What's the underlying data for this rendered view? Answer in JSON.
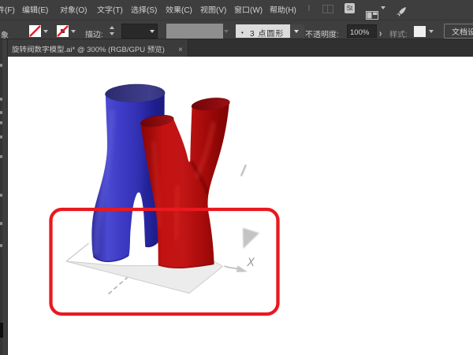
{
  "menu": {
    "items": [
      "文件(F)",
      "编辑(E)",
      "对象(O)",
      "文字(T)",
      "选择(S)",
      "效果(C)",
      "视图(V)",
      "窗口(W)",
      "帮助(H)"
    ],
    "stock_badge": "St"
  },
  "control_bar": {
    "selection_label_fragment": "象",
    "stroke_label": "描边:",
    "brush_bullet": "•",
    "brush_value": "3 点圆形",
    "opacity_label": "不透明度:",
    "opacity_value": "100%",
    "opacity_more": "›",
    "style_label": "样式:",
    "document_setup_label": "文档设置"
  },
  "document_tab": {
    "title": "旋转阀数字模型.ai* @ 300% (RGB/GPU 预览)",
    "close": "×"
  },
  "artwork": {
    "axis_label": "X",
    "colors": {
      "tube_blue": "#3e3cc6",
      "tube_blue_dark": "#1b1a7e",
      "blue_cap_left": "#2c2b6e",
      "blue_cap_right": "#3f3e8c",
      "tube_red": "#c21515",
      "tube_red_dark": "#7c0404",
      "red_cap_left": "#6f0406",
      "red_cap_right": "#a01216",
      "annotation_red": "#e9191f",
      "ground_fill": "#ededed",
      "ground_edge": "#c9c9c9",
      "axis_gray": "#c5c5c5",
      "axis_text": "#9c9c9c"
    }
  }
}
